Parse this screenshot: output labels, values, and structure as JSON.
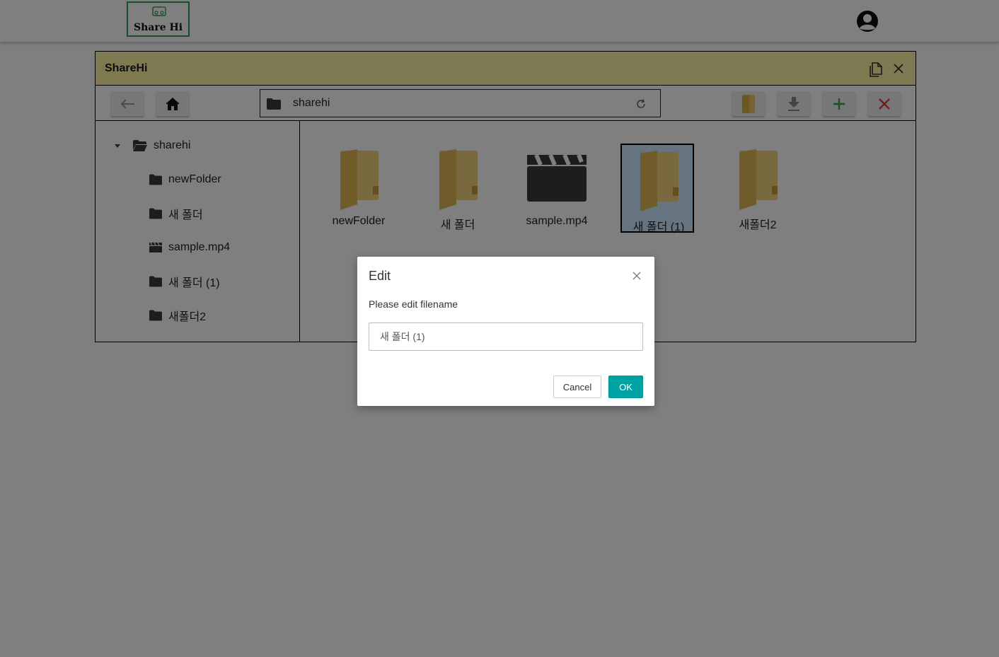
{
  "header": {
    "logo_text": "Share Hi",
    "avatar_icon": "user-avatar-icon"
  },
  "file_manager": {
    "title": "ShareHi",
    "title_bar_color": "#fdf3a3",
    "address": "sharehi",
    "toolbar": {
      "back_icon": "arrow-left-icon",
      "home_icon": "home-icon",
      "rename_icon": "folder-icon",
      "download_icon": "download-icon",
      "add_icon": "plus-icon",
      "delete_icon": "close-icon"
    },
    "tree": {
      "root": "sharehi",
      "items": [
        {
          "label": "newFolder",
          "icon": "folder-icon"
        },
        {
          "label": "새 폴더",
          "icon": "folder-icon"
        },
        {
          "label": "sample.mp4",
          "icon": "video-icon"
        },
        {
          "label": "새 폴더 (1)",
          "icon": "folder-icon"
        },
        {
          "label": "새폴더2",
          "icon": "folder-icon"
        }
      ]
    },
    "grid": {
      "items": [
        {
          "label": "newFolder",
          "icon": "folder-icon"
        },
        {
          "label": "새 폴더",
          "icon": "folder-icon"
        },
        {
          "label": "sample.mp4",
          "icon": "video-icon"
        },
        {
          "label": "새 폴더 (1)",
          "icon": "folder-icon",
          "selected": true
        },
        {
          "label": "새폴더2",
          "icon": "folder-icon"
        }
      ]
    }
  },
  "dialog": {
    "title": "Edit",
    "message": "Please edit filename",
    "input_value": "새 폴더 (1)",
    "cancel_label": "Cancel",
    "ok_label": "OK",
    "ok_color": "#00a3a3"
  }
}
